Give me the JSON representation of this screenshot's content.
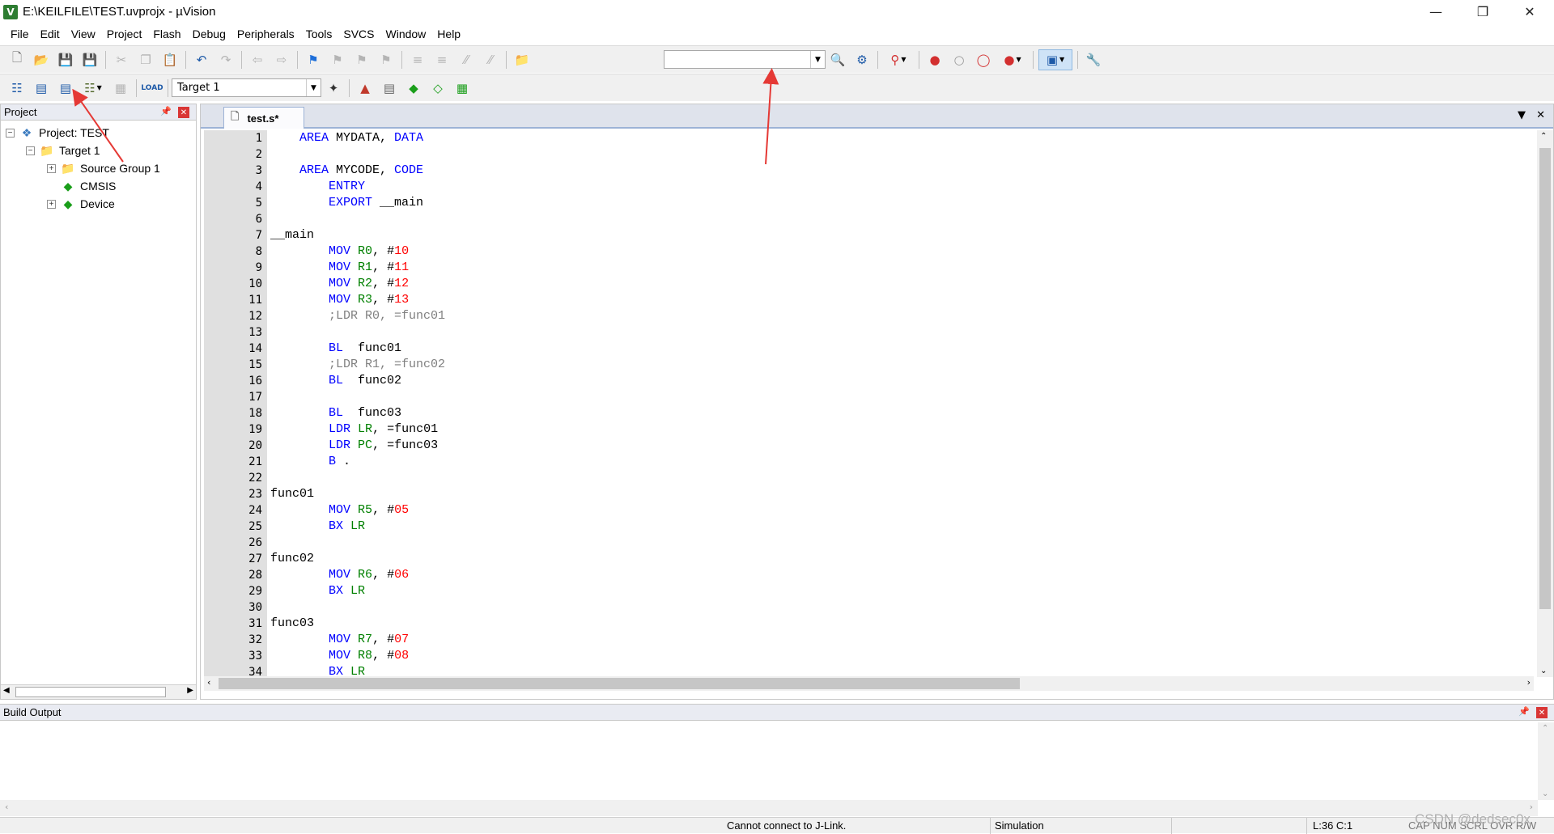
{
  "window": {
    "title": "E:\\KEILFILE\\TEST.uvprojx - µVision",
    "icon": "app-icon",
    "controls": [
      "minimize-icon",
      "restore-icon",
      "close-icon"
    ]
  },
  "menu": [
    "File",
    "Edit",
    "View",
    "Project",
    "Flash",
    "Debug",
    "Peripherals",
    "Tools",
    "SVCS",
    "Window",
    "Help"
  ],
  "toolbar2": {
    "target": "Target 1"
  },
  "project_panel": {
    "title": "Project",
    "tree": [
      {
        "label": "Project: TEST",
        "icon": "project-icon"
      },
      {
        "label": "Target 1",
        "icon": "target-folder-icon"
      },
      {
        "label": "Source Group 1",
        "icon": "folder-icon"
      },
      {
        "label": "CMSIS",
        "icon": "green-diamond-icon"
      },
      {
        "label": "Device",
        "icon": "green-diamond-icon"
      }
    ]
  },
  "editor": {
    "tab": "test.s*",
    "lines": [
      "    AREA MYDATA, DATA",
      "",
      "    AREA MYCODE, CODE",
      "        ENTRY",
      "        EXPORT __main",
      "",
      "__main",
      "        MOV R0, #10",
      "        MOV R1, #11",
      "        MOV R2, #12",
      "        MOV R3, #13",
      "        ;LDR R0, =func01",
      "",
      "        BL  func01",
      "        ;LDR R1, =func02",
      "        BL  func02",
      "",
      "        BL  func03",
      "        LDR LR, =func01",
      "        LDR PC, =func03",
      "        B .",
      "",
      "func01",
      "        MOV R5, #05",
      "        BX LR",
      "",
      "func02",
      "        MOV R6, #06",
      "        BX LR",
      "",
      "func03",
      "        MOV R7, #07",
      "        MOV R8, #08",
      "        BX LR"
    ]
  },
  "build_output": {
    "title": "Build Output"
  },
  "status": {
    "message": "Cannot connect to J-Link.",
    "mode": "Simulation",
    "position": "L:36 C:1",
    "flags": "CAP NUM SCRL OVR R/W",
    "watermark": "CSDN @dedsec0x"
  },
  "colors": {
    "keyword": "#0000ff",
    "register": "#008000",
    "number": "#ff0000",
    "comment": "#808080",
    "annotation_arrow": "#e53935"
  }
}
